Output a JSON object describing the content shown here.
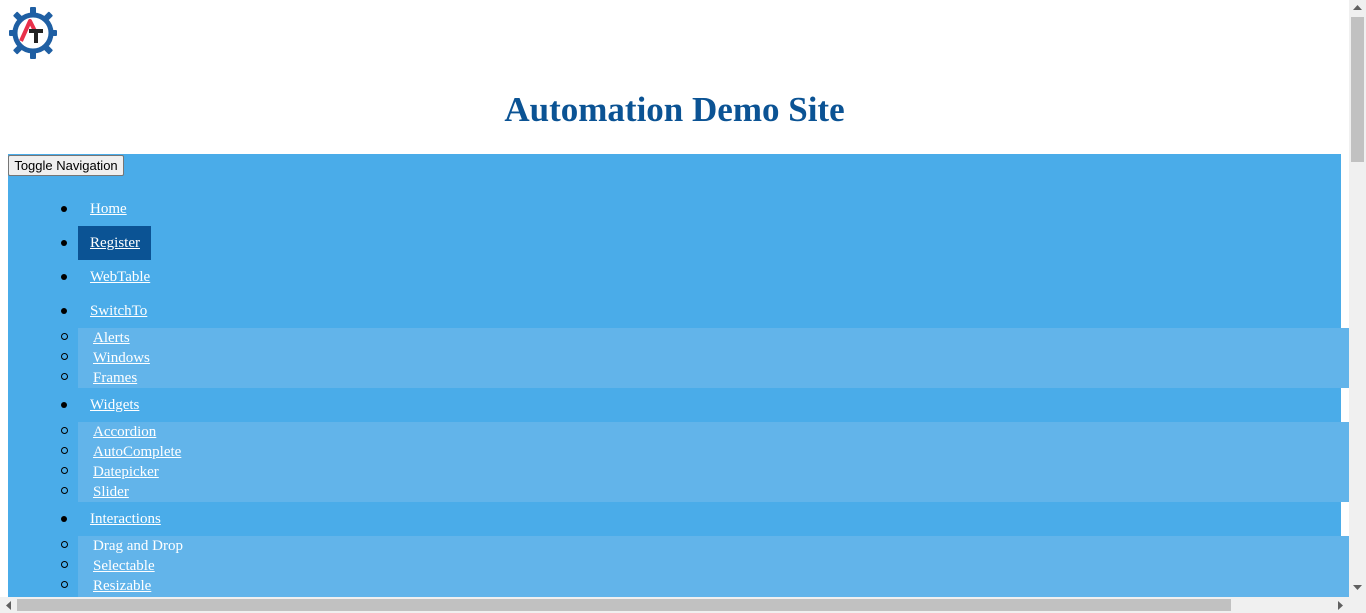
{
  "header": {
    "title": "Automation Demo Site",
    "logo_icon": "automation-testing-gear-logo"
  },
  "nav": {
    "toggle_label": "Toggle Navigation",
    "background": "#4aace9",
    "active_color": "#0b5394",
    "items": [
      {
        "label": "Home"
      },
      {
        "label": "Register",
        "active": true
      },
      {
        "label": "WebTable"
      },
      {
        "label": "SwitchTo",
        "children": [
          "Alerts",
          "Windows",
          "Frames"
        ]
      },
      {
        "label": "Widgets",
        "children": [
          "Accordion",
          "AutoComplete",
          "Datepicker",
          "Slider"
        ]
      },
      {
        "label": "Interactions",
        "children": [
          "Drag and Drop",
          "Selectable",
          "Resizable"
        ]
      }
    ]
  },
  "colors": {
    "title": "#0b5394",
    "submenu_bg": "#62b4ea"
  }
}
